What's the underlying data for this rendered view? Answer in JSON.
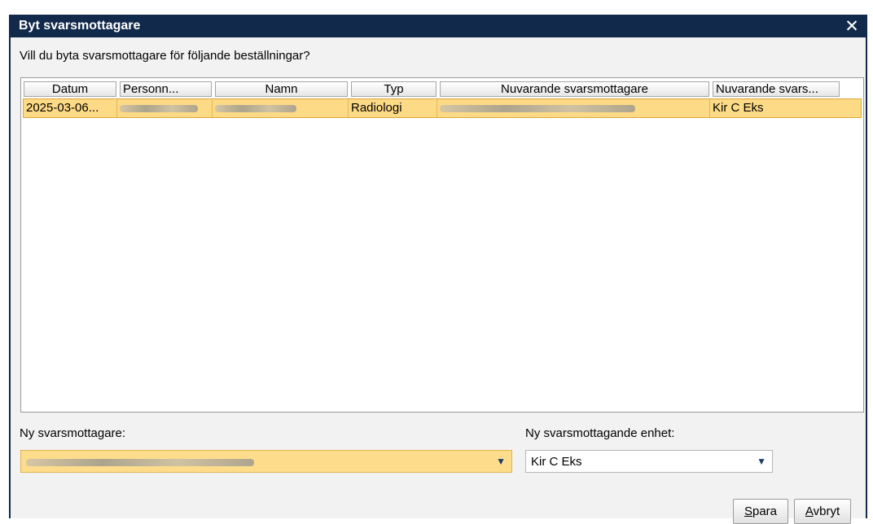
{
  "dialog": {
    "title": "Byt svarsmottagare",
    "close_glyph": "✕",
    "question": "Vill du byta svarsmottagare för följande beställningar?"
  },
  "table": {
    "columns": [
      "Datum",
      "Personn...",
      "Namn",
      "Typ",
      "Nuvarande svarsmottagare",
      "Nuvarande svars..."
    ],
    "rows": [
      {
        "datum": "2025-03-06...",
        "personnummer": "",
        "namn": "",
        "typ": "Radiologi",
        "nuvarande_svarsmottagare": "",
        "nuvarande_enhet": "Kir C Eks"
      }
    ],
    "selected_row_color": "#fdda85"
  },
  "form": {
    "recipient_label": "Ny svarsmottagare:",
    "recipient_value": "",
    "unit_label": "Ny svarsmottagande enhet:",
    "unit_value": "Kir C Eks",
    "dropdown_arrow": "▼"
  },
  "buttons": {
    "save_mnemonic": "S",
    "save_rest": "para",
    "cancel_mnemonic": "A",
    "cancel_rest": "vbryt"
  },
  "colors": {
    "titlebar": "#11294a",
    "highlight": "#fddc8b"
  }
}
